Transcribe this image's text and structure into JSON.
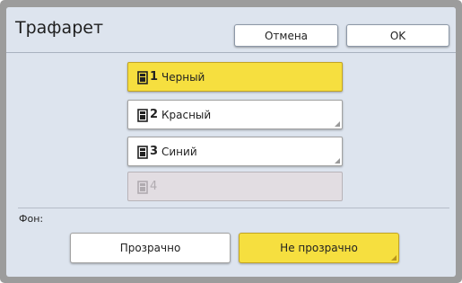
{
  "dialog": {
    "title": "Трафарет",
    "cancel_label": "Отмена",
    "ok_label": "OK"
  },
  "drums": [
    {
      "number": "1",
      "label": "Черный",
      "state": "selected"
    },
    {
      "number": "2",
      "label": "Красный",
      "state": "normal"
    },
    {
      "number": "3",
      "label": "Синий",
      "state": "normal"
    },
    {
      "number": "4",
      "label": "",
      "state": "disabled"
    }
  ],
  "background": {
    "label": "Фон:",
    "options": [
      {
        "label": "Прозрачно",
        "selected": false
      },
      {
        "label": "Не прозрачно",
        "selected": true
      }
    ]
  },
  "colors": {
    "selected": "#f6df3f",
    "panel": "#dde4ee",
    "frame": "#9c9c9c",
    "disabled": "#e2dde2"
  }
}
